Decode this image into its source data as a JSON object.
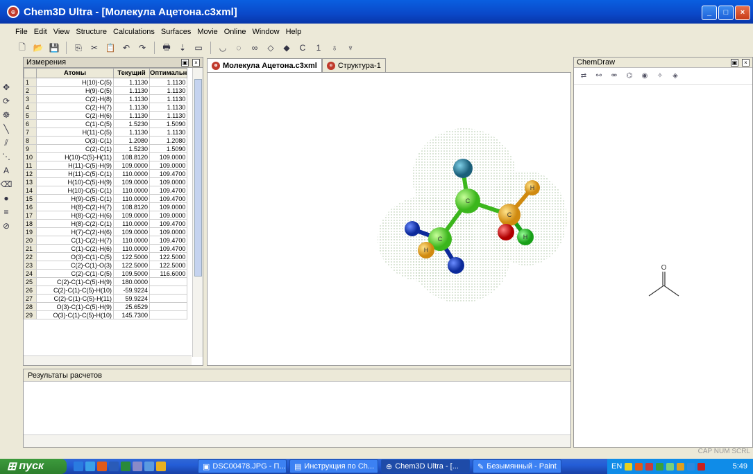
{
  "window": {
    "title": "Chem3D Ultra - [Молекула Ацетона.c3xml]"
  },
  "menu": [
    "File",
    "Edit",
    "View",
    "Structure",
    "Calculations",
    "Surfaces",
    "Movie",
    "Online",
    "Window",
    "Help"
  ],
  "measurements": {
    "title": "Измерения",
    "columns": [
      "Атомы",
      "Текущий",
      "Оптимальн"
    ],
    "rows": [
      {
        "n": "1",
        "atoms": "H(10)-C(5)",
        "cur": "1.1130",
        "opt": "1.1130"
      },
      {
        "n": "2",
        "atoms": "H(9)-C(5)",
        "cur": "1.1130",
        "opt": "1.1130"
      },
      {
        "n": "3",
        "atoms": "C(2)-H(8)",
        "cur": "1.1130",
        "opt": "1.1130"
      },
      {
        "n": "4",
        "atoms": "C(2)-H(7)",
        "cur": "1.1130",
        "opt": "1.1130"
      },
      {
        "n": "5",
        "atoms": "C(2)-H(6)",
        "cur": "1.1130",
        "opt": "1.1130"
      },
      {
        "n": "6",
        "atoms": "C(1)-C(5)",
        "cur": "1.5230",
        "opt": "1.5090"
      },
      {
        "n": "7",
        "atoms": "H(11)-C(5)",
        "cur": "1.1130",
        "opt": "1.1130"
      },
      {
        "n": "8",
        "atoms": "O(3)-C(1)",
        "cur": "1.2080",
        "opt": "1.2080"
      },
      {
        "n": "9",
        "atoms": "C(2)-C(1)",
        "cur": "1.5230",
        "opt": "1.5090"
      },
      {
        "n": "10",
        "atoms": "H(10)-C(5)-H(11)",
        "cur": "108.8120",
        "opt": "109.0000"
      },
      {
        "n": "11",
        "atoms": "H(11)-C(5)-H(9)",
        "cur": "109.0000",
        "opt": "109.0000"
      },
      {
        "n": "12",
        "atoms": "H(11)-C(5)-C(1)",
        "cur": "110.0000",
        "opt": "109.4700"
      },
      {
        "n": "13",
        "atoms": "H(10)-C(5)-H(9)",
        "cur": "109.0000",
        "opt": "109.0000"
      },
      {
        "n": "14",
        "atoms": "H(10)-C(5)-C(1)",
        "cur": "110.0000",
        "opt": "109.4700"
      },
      {
        "n": "15",
        "atoms": "H(9)-C(5)-C(1)",
        "cur": "110.0000",
        "opt": "109.4700"
      },
      {
        "n": "16",
        "atoms": "H(8)-C(2)-H(7)",
        "cur": "108.8120",
        "opt": "109.0000"
      },
      {
        "n": "17",
        "atoms": "H(8)-C(2)-H(6)",
        "cur": "109.0000",
        "opt": "109.0000"
      },
      {
        "n": "18",
        "atoms": "H(8)-C(2)-C(1)",
        "cur": "110.0000",
        "opt": "109.4700"
      },
      {
        "n": "19",
        "atoms": "H(7)-C(2)-H(6)",
        "cur": "109.0000",
        "opt": "109.0000"
      },
      {
        "n": "20",
        "atoms": "C(1)-C(2)-H(7)",
        "cur": "110.0000",
        "opt": "109.4700"
      },
      {
        "n": "21",
        "atoms": "C(1)-C(2)-H(6)",
        "cur": "110.0000",
        "opt": "109.4700"
      },
      {
        "n": "22",
        "atoms": "O(3)-C(1)-C(5)",
        "cur": "122.5000",
        "opt": "122.5000"
      },
      {
        "n": "23",
        "atoms": "C(2)-C(1)-O(3)",
        "cur": "122.5000",
        "opt": "122.5000"
      },
      {
        "n": "24",
        "atoms": "C(2)-C(1)-C(5)",
        "cur": "109.5000",
        "opt": "116.6000"
      },
      {
        "n": "25",
        "atoms": "C(2)-C(1)-C(5)-H(9)",
        "cur": "180.0000",
        "opt": ""
      },
      {
        "n": "26",
        "atoms": "C(2)-C(1)-C(5)-H(10)",
        "cur": "-59.9224",
        "opt": ""
      },
      {
        "n": "27",
        "atoms": "C(2)-C(1)-C(5)-H(11)",
        "cur": "59.9224",
        "opt": ""
      },
      {
        "n": "28",
        "atoms": "O(3)-C(1)-C(5)-H(9)",
        "cur": "25.6529",
        "opt": ""
      },
      {
        "n": "29",
        "atoms": "O(3)-C(1)-C(5)-H(10)",
        "cur": "145.7300",
        "opt": ""
      }
    ]
  },
  "tabs": [
    "Молекула Ацетона.c3xml",
    "Структура-1"
  ],
  "molecule_atoms": {
    "c": "C",
    "h": "H",
    "o": "O"
  },
  "results": {
    "title": "Результаты расчетов"
  },
  "chemdraw": {
    "title": "ChemDraw",
    "o_label": "O"
  },
  "status": {
    "text": "CAP NUM SCRL"
  },
  "taskbar": {
    "start": "пуск",
    "tasks": [
      "DSC00478.JPG - П...",
      "Инструкция по Ch...",
      "Chem3D Ultra - [...",
      "Безымянный - Paint"
    ],
    "lang": "EN",
    "clock": "5:49"
  }
}
